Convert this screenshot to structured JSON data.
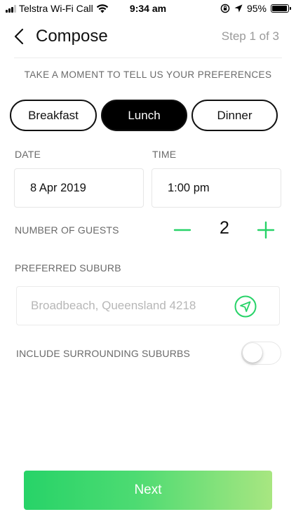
{
  "status_bar": {
    "carrier": "Telstra Wi-Fi Call",
    "time": "9:34 am",
    "battery": "95%",
    "battery_level": 0.95,
    "icons": [
      "signal-icon",
      "wifi-icon",
      "orientation-lock-icon",
      "location-arrow-icon",
      "battery-icon"
    ]
  },
  "header": {
    "back_icon": "chevron-left-icon",
    "title": "Compose",
    "step": "Step 1 of 3"
  },
  "subtitle": "TAKE A MOMENT TO TELL US YOUR PREFERENCES",
  "meals": [
    {
      "label": "Breakfast",
      "selected": false
    },
    {
      "label": "Lunch",
      "selected": true
    },
    {
      "label": "Dinner",
      "selected": false
    }
  ],
  "date": {
    "label": "DATE",
    "value": "8 Apr 2019"
  },
  "time": {
    "label": "TIME",
    "value": "1:00 pm"
  },
  "guests": {
    "label": "NUMBER OF GUESTS",
    "value": "2",
    "decrement_icon": "minus-icon",
    "increment_icon": "plus-icon"
  },
  "suburb": {
    "label": "PREFERRED SUBURB",
    "value": "",
    "placeholder": "Broadbeach, Queensland 4218",
    "locate_icon": "location-arrow-icon"
  },
  "surrounding": {
    "label": "INCLUDE SURROUNDING SUBURBS",
    "enabled": false
  },
  "next_label": "Next",
  "colors": {
    "accent_green": "#27d368",
    "gradient_end": "#a8e681",
    "selected_meal_bg": "#000000",
    "muted_text": "#6a6a6a",
    "placeholder_text": "#b7b7b7"
  }
}
